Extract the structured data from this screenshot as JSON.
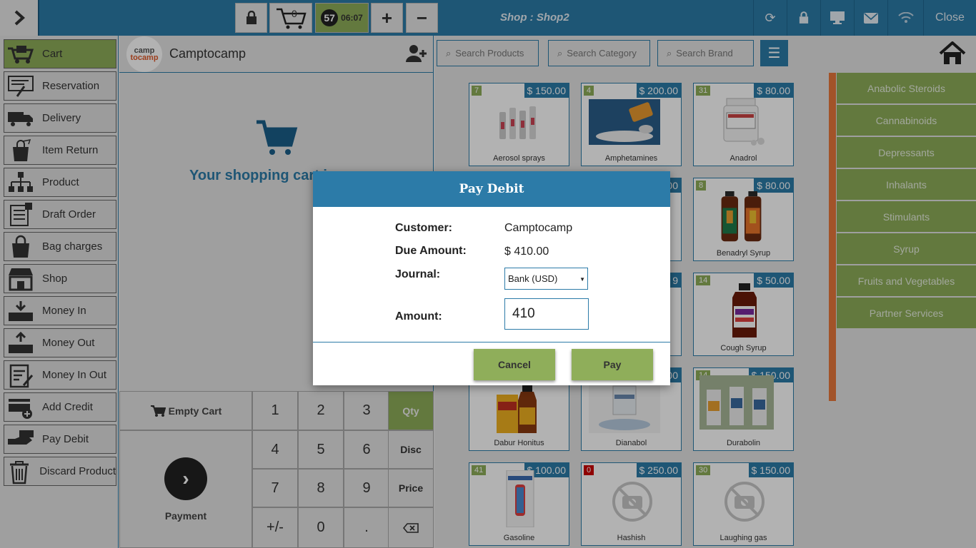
{
  "topbar": {
    "cart_count": "0",
    "order_count": "57",
    "timer": "06:07",
    "plus": "+",
    "minus": "−",
    "shop_title": "Shop : Shop2",
    "close": "Close"
  },
  "sidebar": {
    "items": [
      {
        "label": "Cart"
      },
      {
        "label": "Reservation"
      },
      {
        "label": "Delivery"
      },
      {
        "label": "Item Return"
      },
      {
        "label": "Product"
      },
      {
        "label": "Draft Order"
      },
      {
        "label": "Bag charges"
      },
      {
        "label": "Shop"
      },
      {
        "label": "Money In"
      },
      {
        "label": "Money Out"
      },
      {
        "label": "Money In Out"
      },
      {
        "label": "Add Credit"
      },
      {
        "label": "Pay Debit"
      },
      {
        "label": "Discard Product"
      }
    ]
  },
  "cart": {
    "customer": "Camptocamp",
    "logo_top": "camp",
    "logo_bottom": "tocamp",
    "empty_message": "Your shopping cart i",
    "empty_cart": "Empty Cart",
    "payment": "Payment",
    "keys": [
      "1",
      "2",
      "3",
      "Qty",
      "4",
      "5",
      "6",
      "Disc",
      "7",
      "8",
      "9",
      "Price",
      "+/-",
      "0",
      "."
    ]
  },
  "search": {
    "products": "Search Products",
    "category": "Search Category",
    "brand": "Search Brand"
  },
  "products": [
    {
      "name": "Aerosol sprays",
      "price": "$ 150.00",
      "qty": "7"
    },
    {
      "name": "Amphetamines",
      "price": "$ 200.00",
      "qty": "4"
    },
    {
      "name": "Anadrol",
      "price": "$ 80.00",
      "qty": "31"
    },
    {
      "name": "Benadryl Syrup",
      "price": "$ 80.00",
      "qty": "8"
    },
    {
      "name": "Cough Syrup",
      "price": "$ 50.00",
      "qty": "14"
    },
    {
      "name": "Dabur Honitus",
      "price": "",
      "qty": ""
    },
    {
      "name": "Dianabol",
      "price": "",
      "qty": ""
    },
    {
      "name": "Durabolin",
      "price": "$ 150.00",
      "qty": "14"
    },
    {
      "name": "Gasoline",
      "price": "$ 100.00",
      "qty": "41"
    },
    {
      "name": "Hashish",
      "price": "$ 250.00",
      "qty": "0"
    },
    {
      "name": "Laughing gas",
      "price": "$ 150.00",
      "qty": "30"
    }
  ],
  "partial_prices": [
    "00",
    "9",
    "00"
  ],
  "categories": [
    "Anabolic Steroids",
    "Cannabinoids",
    "Depressants",
    "Inhalants",
    "Stimulants",
    "Syrup",
    "Fruits and Vegetables",
    "Partner Services"
  ],
  "modal": {
    "title": "Pay Debit",
    "customer_label": "Customer:",
    "customer_value": "Camptocamp",
    "due_label": "Due Amount:",
    "due_value": "$ 410.00",
    "journal_label": "Journal:",
    "journal_value": "Bank (USD)",
    "amount_label": "Amount:",
    "amount_value": "410",
    "cancel": "Cancel",
    "pay": "Pay"
  },
  "colors": {
    "primary": "#2c7ba8",
    "accent_green": "#8fae5a",
    "category_bar": "#e8783c"
  }
}
